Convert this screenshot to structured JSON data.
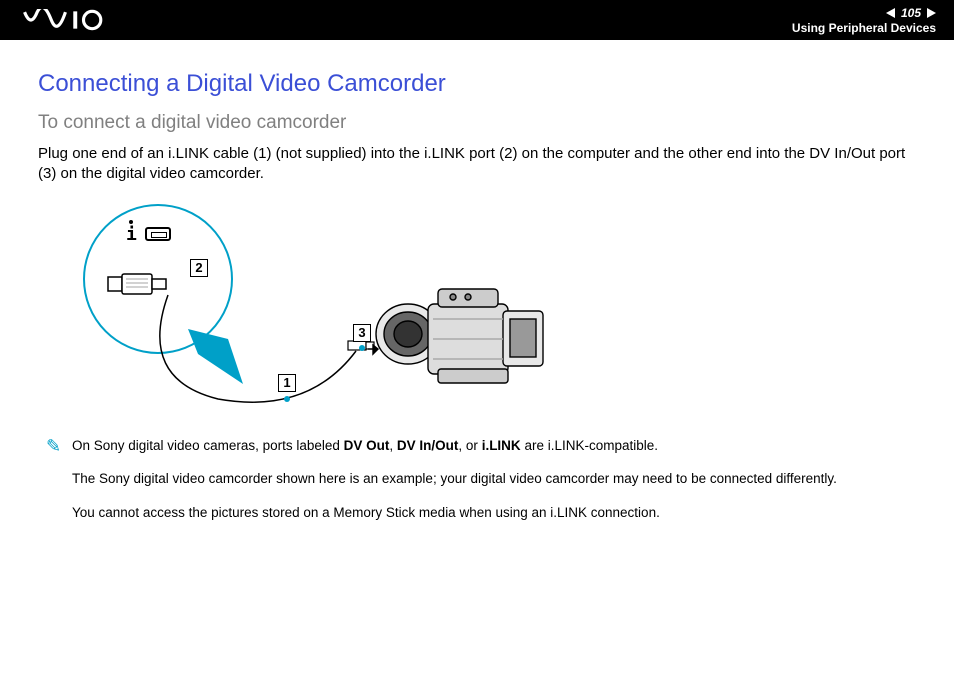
{
  "header": {
    "page_number": "105",
    "section": "Using Peripheral Devices"
  },
  "content": {
    "title": "Connecting a Digital Video Camcorder",
    "subtitle": "To connect a digital video camcorder",
    "body": "Plug one end of an i.LINK cable (1) (not supplied) into the i.LINK port (2) on the computer and the other end into the DV In/Out port (3) on the digital video camcorder."
  },
  "diagram": {
    "labels": {
      "n1": "1",
      "n2": "2",
      "n3": "3"
    }
  },
  "notes": {
    "line1_pre": "On Sony digital video cameras, ports labeled ",
    "line1_b1": "DV Out",
    "line1_mid1": ", ",
    "line1_b2": "DV In/Out",
    "line1_mid2": ", or ",
    "line1_b3": "i.LINK",
    "line1_post": " are i.LINK-compatible.",
    "line2": "The Sony digital video camcorder shown here is an example; your digital video camcorder may need to be connected differently.",
    "line3": "You cannot access the pictures stored on a Memory Stick media when using an i.LINK connection."
  }
}
